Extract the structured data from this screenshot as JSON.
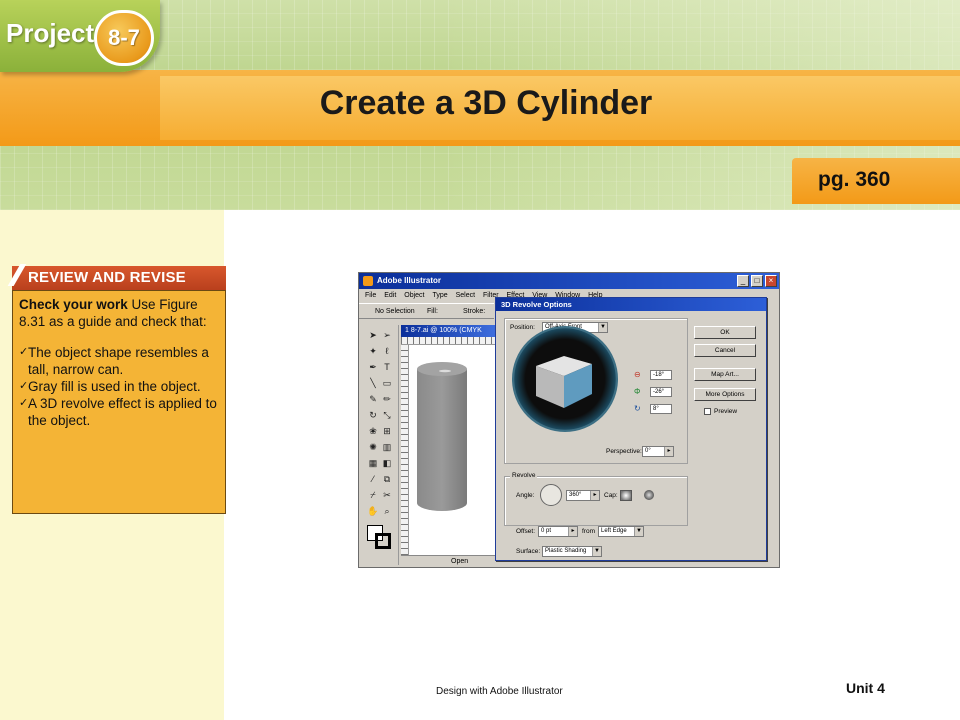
{
  "header": {
    "project_label": "Project",
    "project_number": "8-7",
    "title": "Create a 3D Cylinder",
    "page_ref": "pg. 360"
  },
  "review": {
    "header": "REVIEW AND REVISE",
    "lead_bold": "Check your work",
    "lead_rest": "  Use Figure 8.31 as a guide and check that:",
    "items": [
      "The object shape resembles a tall, narrow can.",
      "Gray fill is used in the object.",
      "A 3D revolve effect is applied to the object."
    ]
  },
  "screenshot": {
    "app_title": "Adobe Illustrator",
    "menu": [
      "File",
      "Edit",
      "Object",
      "Type",
      "Select",
      "Filter",
      "Effect",
      "View",
      "Window",
      "Help"
    ],
    "control_bar": {
      "selection": "No Selection",
      "fill": "Fill:",
      "stroke": "Stroke:"
    },
    "doc_tab": "1 8-7.ai @ 100% (CMYK",
    "status": "Open",
    "dialog": {
      "title": "3D Revolve Options",
      "position_label": "Position:",
      "position_value": "Off-Axis Front",
      "angle_x": "-18°",
      "angle_y": "-26°",
      "angle_z": "8°",
      "perspective_label": "Perspective:",
      "perspective_value": "0°",
      "revolve_group": "Revolve",
      "angle_label": "Angle:",
      "angle_value": "360°",
      "cap_label": "Cap:",
      "offset_label": "Offset:",
      "offset_value": "0 pt",
      "from_label": "from",
      "from_value": "Left Edge",
      "surface_label": "Surface:",
      "surface_value": "Plastic Shading",
      "buttons": {
        "ok": "OK",
        "cancel": "Cancel",
        "map_art": "Map Art...",
        "more_options": "More Options"
      },
      "preview_label": "Preview"
    },
    "colors": {
      "cube_face": "#5f9bbf",
      "cube_top": "#e4e4e4",
      "cube_left": "#b9b9b9",
      "cylinder": "#8c8c8c"
    }
  },
  "footer": {
    "course": "Design with Adobe Illustrator",
    "unit": "Unit 4"
  }
}
